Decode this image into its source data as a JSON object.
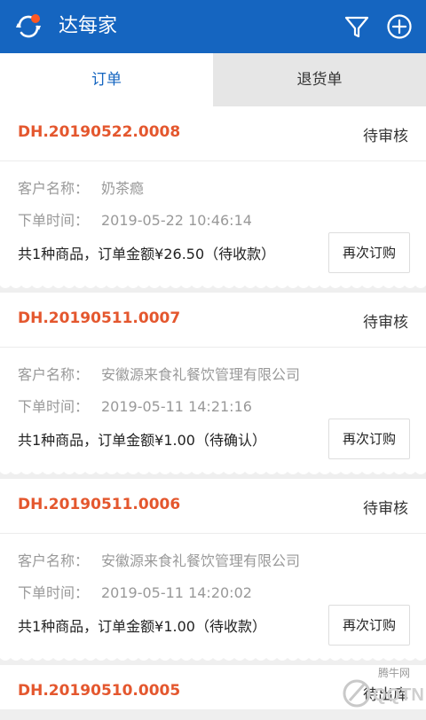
{
  "app": {
    "title": "达每家"
  },
  "tabs": [
    {
      "label": "订单",
      "active": true
    },
    {
      "label": "退货单",
      "active": false
    }
  ],
  "labels": {
    "customer": "客户名称：",
    "order_time": "下单时间：",
    "reorder": "再次订购"
  },
  "orders": [
    {
      "order_no": "DH.20190522.0008",
      "status": "待审核",
      "customer": "奶茶瘾",
      "time": "2019-05-22 10:46:14",
      "summary": "共1种商品，订单金额¥26.50（待收款）"
    },
    {
      "order_no": "DH.20190511.0007",
      "status": "待审核",
      "customer": "安徽源来食礼餐饮管理有限公司",
      "time": "2019-05-11 14:21:16",
      "summary": "共1种商品，订单金额¥1.00（待确认）"
    },
    {
      "order_no": "DH.20190511.0006",
      "status": "待审核",
      "customer": "安徽源来食礼餐饮管理有限公司",
      "time": "2019-05-11 14:20:02",
      "summary": "共1种商品，订单金额¥1.00（待收款）"
    },
    {
      "order_no": "DH.20190510.0005",
      "status": "待出库"
    }
  ],
  "watermark": {
    "text": "腾牛网"
  },
  "colors": {
    "primary": "#1565c0",
    "accent": "#e4572e",
    "logo_dot": "#ff5722"
  },
  "icons": {
    "logo": "refresh-logo-icon",
    "filter": "filter-icon",
    "add": "add-circle-icon"
  }
}
